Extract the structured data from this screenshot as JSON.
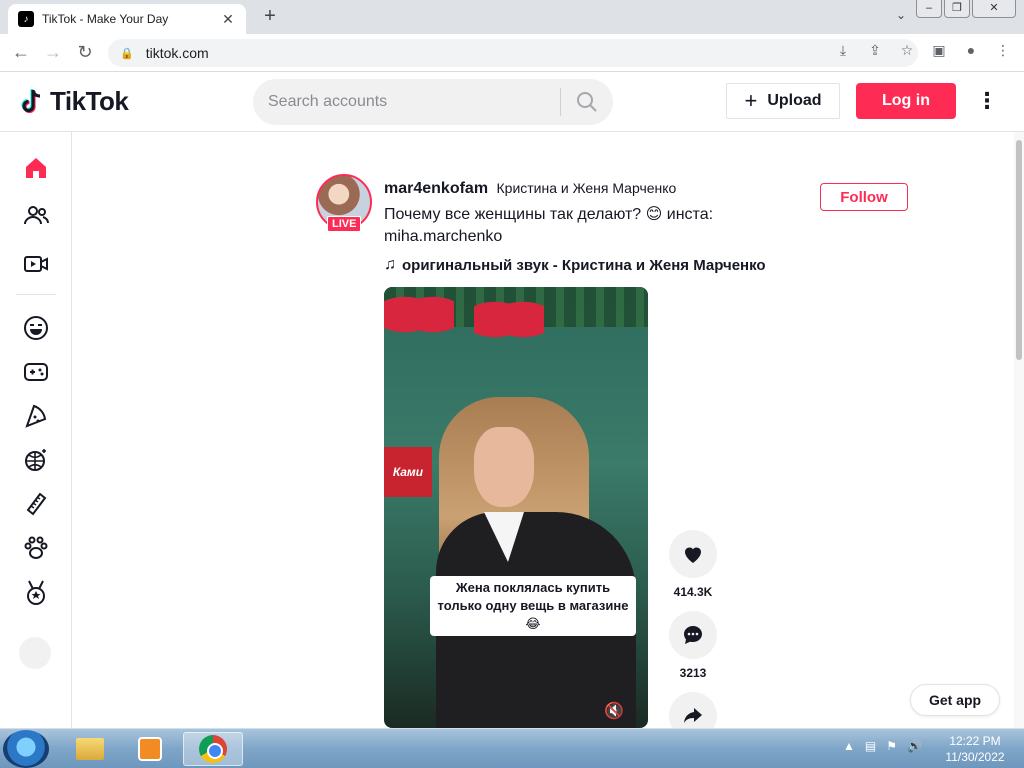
{
  "browser": {
    "tab_title": "TikTok - Make Your Day",
    "tab_close": "✕",
    "new_tab": "+",
    "url": "tiktok.com",
    "window_minimize": "–",
    "window_restore": "❐",
    "window_close": "✕"
  },
  "header": {
    "logo_text": "TikTok",
    "search_placeholder": "Search accounts",
    "upload_label": "Upload",
    "login_label": "Log in",
    "brand_color": "#fe2c55"
  },
  "sidebar": {
    "items": [
      {
        "icon": "home-icon"
      },
      {
        "icon": "following-icon"
      },
      {
        "icon": "live-icon"
      },
      {
        "icon": "comedy-icon"
      },
      {
        "icon": "gaming-icon"
      },
      {
        "icon": "food-icon"
      },
      {
        "icon": "dance-icon"
      },
      {
        "icon": "beauty-icon"
      },
      {
        "icon": "animals-icon"
      },
      {
        "icon": "sports-icon"
      }
    ]
  },
  "post": {
    "username": "mar4enkofam",
    "nickname": "Кристина и Женя Марченко",
    "live_badge": "LIVE",
    "description_line1": "Почему все женщины так делают? 😊 инста:",
    "description_line2": "miha.marchenko",
    "music": "оригинальный звук - Кристина и Женя Марченко",
    "follow_label": "Follow",
    "video_caption": "Жена поклялась купить только одну вещь в магазине 😂",
    "sign_text": "Ками",
    "likes": "414.3K",
    "comments": "3213"
  },
  "get_app_label": "Get app",
  "taskbar": {
    "time": "12:22 PM",
    "date": "11/30/2022"
  }
}
